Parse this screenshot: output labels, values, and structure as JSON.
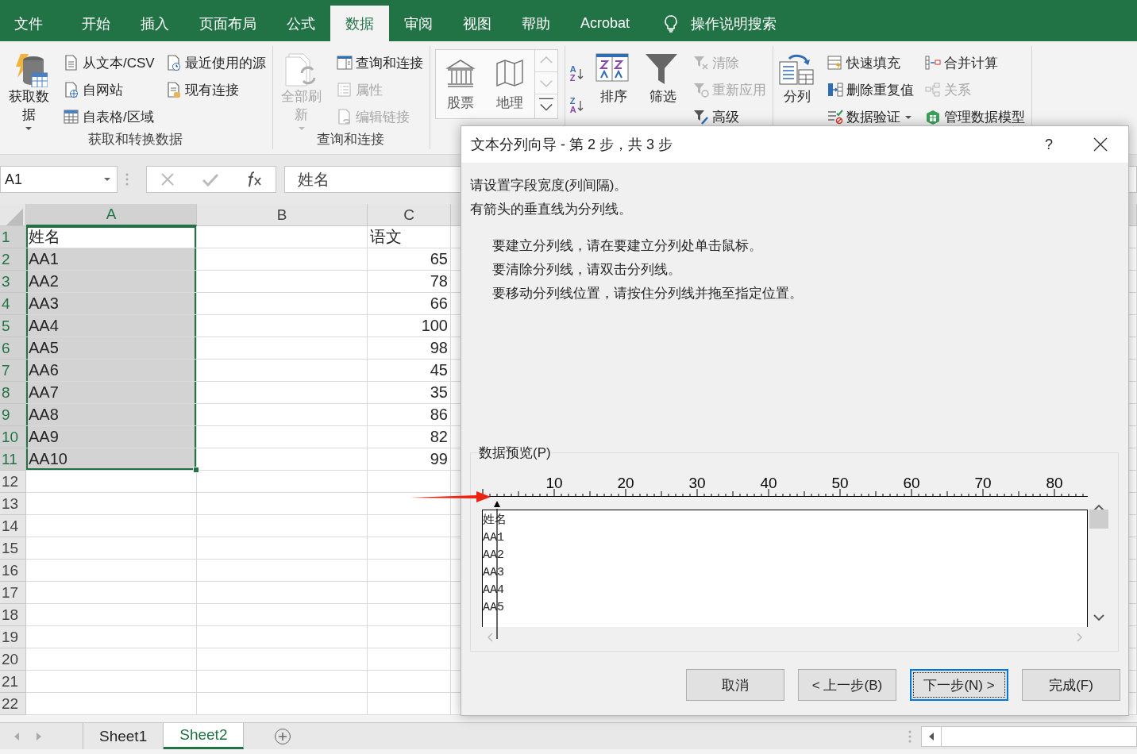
{
  "menu_tabs": [
    {
      "label": "文件",
      "selected": false
    },
    {
      "label": "开始",
      "selected": false
    },
    {
      "label": "插入",
      "selected": false
    },
    {
      "label": "页面布局",
      "selected": false
    },
    {
      "label": "公式",
      "selected": false
    },
    {
      "label": "数据",
      "selected": true
    },
    {
      "label": "审阅",
      "selected": false
    },
    {
      "label": "视图",
      "selected": false
    },
    {
      "label": "帮助",
      "selected": false
    },
    {
      "label": "Acrobat",
      "selected": false
    }
  ],
  "tell_me": {
    "label": "操作说明搜索"
  },
  "ribbon": {
    "groups": [
      {
        "label": "获取和转换数据",
        "items": [
          {
            "kind": "large",
            "label": "获取数据",
            "disabled": false,
            "dropdown": true
          },
          {
            "kind": "small",
            "label": "从文本/CSV",
            "disabled": false
          },
          {
            "kind": "small",
            "label": "自网站",
            "disabled": false
          },
          {
            "kind": "small",
            "label": "自表格/区域",
            "disabled": false
          },
          {
            "kind": "small",
            "label": "最近使用的源",
            "disabled": false
          },
          {
            "kind": "small",
            "label": "现有连接",
            "disabled": false
          }
        ]
      },
      {
        "label": "查询和连接",
        "items": [
          {
            "kind": "large",
            "label": "全部刷新",
            "disabled": true,
            "dropdown": true
          },
          {
            "kind": "small",
            "label": "查询和连接",
            "disabled": false
          },
          {
            "kind": "small",
            "label": "属性",
            "disabled": true
          },
          {
            "kind": "small",
            "label": "编辑链接",
            "disabled": true
          }
        ]
      },
      {
        "items": [
          {
            "kind": "gallery",
            "label": "股票"
          },
          {
            "kind": "gallery",
            "label": "地理"
          }
        ]
      },
      {
        "items": [
          {
            "kind": "sort",
            "letters": [
              "A",
              "Z"
            ]
          },
          {
            "kind": "sort",
            "letters": [
              "Z",
              "A"
            ]
          },
          {
            "kind": "large",
            "label": "排序",
            "disabled": false
          },
          {
            "kind": "large",
            "label": "筛选",
            "disabled": false
          },
          {
            "kind": "small",
            "label": "清除",
            "disabled": true
          },
          {
            "kind": "small",
            "label": "重新应用",
            "disabled": true
          },
          {
            "kind": "small",
            "label": "高级",
            "disabled": false
          }
        ]
      },
      {
        "items": [
          {
            "kind": "large",
            "label": "分列",
            "disabled": false
          },
          {
            "kind": "small",
            "label": "快速填充",
            "disabled": false
          },
          {
            "kind": "small",
            "label": "删除重复值",
            "disabled": false
          },
          {
            "kind": "small",
            "label": "数据验证",
            "disabled": false,
            "dropdown": true
          },
          {
            "kind": "small",
            "label": "合并计算",
            "disabled": false
          },
          {
            "kind": "small",
            "label": "关系",
            "disabled": true
          },
          {
            "kind": "small",
            "label": "管理数据模型",
            "disabled": false
          }
        ]
      }
    ]
  },
  "formula_bar": {
    "name_box": "A1",
    "formula": "姓名"
  },
  "sheet": {
    "columns": [
      {
        "label": "A",
        "selected": true
      },
      {
        "label": "B",
        "selected": false
      },
      {
        "label": "C",
        "selected": false
      }
    ],
    "rows": [
      {
        "number": "1",
        "selected": true,
        "cells": {
          "A": "姓名",
          "C": "语文"
        }
      },
      {
        "number": "2",
        "selected": true,
        "cells": {
          "A": "AA1",
          "C": "65"
        }
      },
      {
        "number": "3",
        "selected": true,
        "cells": {
          "A": "AA2",
          "C": "78"
        }
      },
      {
        "number": "4",
        "selected": true,
        "cells": {
          "A": "AA3",
          "C": "66"
        }
      },
      {
        "number": "5",
        "selected": true,
        "cells": {
          "A": "AA4",
          "C": "100"
        }
      },
      {
        "number": "6",
        "selected": true,
        "cells": {
          "A": "AA5",
          "C": "98"
        }
      },
      {
        "number": "7",
        "selected": true,
        "cells": {
          "A": "AA6",
          "C": "45"
        }
      },
      {
        "number": "8",
        "selected": true,
        "cells": {
          "A": "AA7",
          "C": "35"
        }
      },
      {
        "number": "9",
        "selected": true,
        "cells": {
          "A": "AA8",
          "C": "86"
        }
      },
      {
        "number": "10",
        "selected": true,
        "cells": {
          "A": "AA9",
          "C": "82"
        }
      },
      {
        "number": "11",
        "selected": true,
        "cells": {
          "A": "AA10",
          "C": "99"
        }
      },
      {
        "number": "12",
        "selected": false,
        "cells": {}
      },
      {
        "number": "13",
        "selected": false,
        "cells": {}
      },
      {
        "number": "14",
        "selected": false,
        "cells": {}
      },
      {
        "number": "15",
        "selected": false,
        "cells": {}
      },
      {
        "number": "16",
        "selected": false,
        "cells": {}
      },
      {
        "number": "17",
        "selected": false,
        "cells": {}
      },
      {
        "number": "18",
        "selected": false,
        "cells": {}
      },
      {
        "number": "19",
        "selected": false,
        "cells": {}
      },
      {
        "number": "20",
        "selected": false,
        "cells": {}
      },
      {
        "number": "21",
        "selected": false,
        "cells": {}
      },
      {
        "number": "22",
        "selected": false,
        "cells": {}
      }
    ]
  },
  "sheet_tabs": [
    {
      "label": "Sheet1",
      "selected": false
    },
    {
      "label": "Sheet2",
      "selected": true
    }
  ],
  "dialog": {
    "title": "文本分列向导 - 第 2 步，共 3 步",
    "help": "?",
    "intro": [
      "请设置字段宽度(列间隔)。",
      "有箭头的垂直线为分列线。"
    ],
    "instructions": [
      "要建立分列线，请在要建立分列处单击鼠标。",
      "要清除分列线，请双击分列线。",
      "要移动分列线位置，请按住分列线并拖至指定位置。"
    ],
    "preview": {
      "label": "数据预览(P)",
      "ruler_labels": [
        "10",
        "20",
        "30",
        "40",
        "50",
        "60",
        "70",
        "80"
      ],
      "column_break": {
        "level": 0.0235
      },
      "lines": [
        "姓名",
        "AA1",
        "AA2",
        "AA3",
        "AA4",
        "AA5"
      ]
    },
    "buttons": [
      {
        "label": "取消",
        "focused": false
      },
      {
        "label": "< 上一步(B)",
        "focused": false
      },
      {
        "label": "下一步(N) >",
        "focused": true
      },
      {
        "label": "完成(F)",
        "focused": false
      }
    ]
  }
}
